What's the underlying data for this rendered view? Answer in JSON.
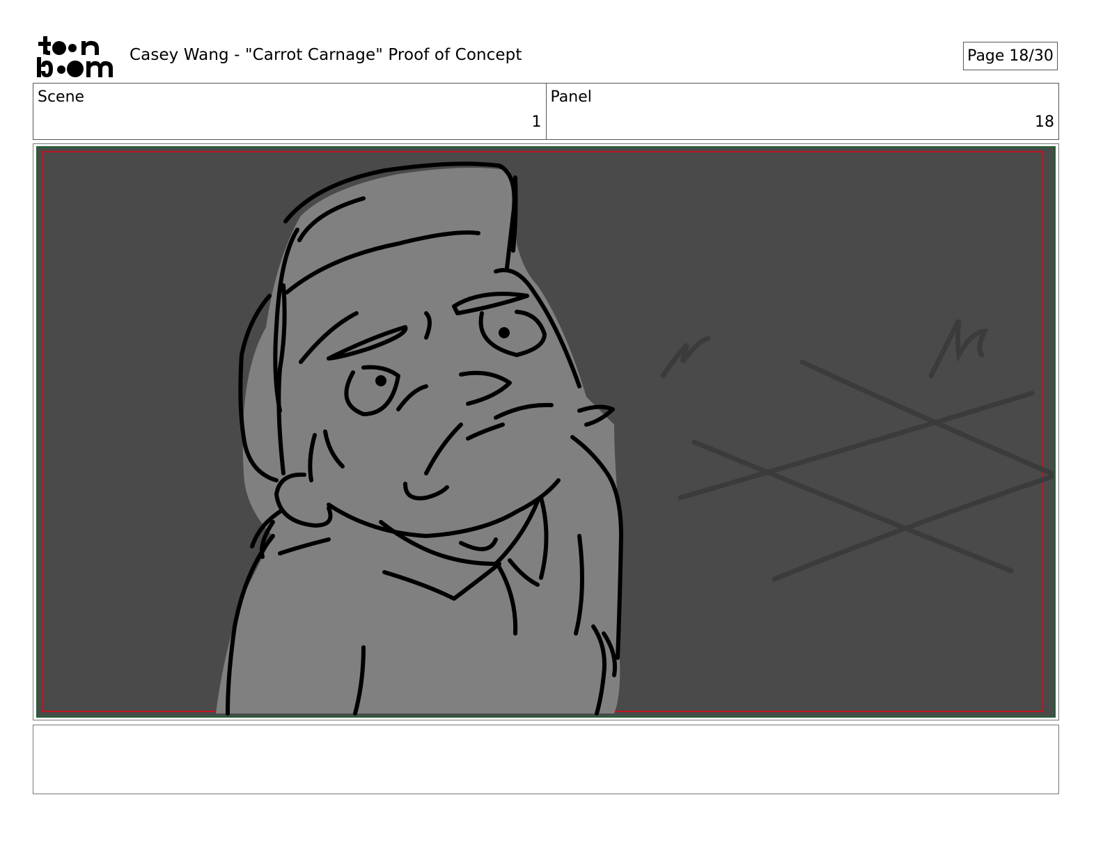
{
  "header": {
    "logo_text": "toon boom",
    "title": "Casey Wang - \"Carrot Carnage\" Proof of Concept",
    "page": "Page 18/30"
  },
  "scene": {
    "label": "Scene",
    "value": "1"
  },
  "panel": {
    "label": "Panel",
    "value": "18"
  },
  "frame": {
    "description_icon": "storyboard-sketch-character",
    "colors": {
      "background": "#4a4a4a",
      "figure": "#808080",
      "ink": "#000000",
      "safe_area": "#c0141e",
      "border_green": "#2e5a3a"
    }
  },
  "notes": {
    "text": ""
  }
}
